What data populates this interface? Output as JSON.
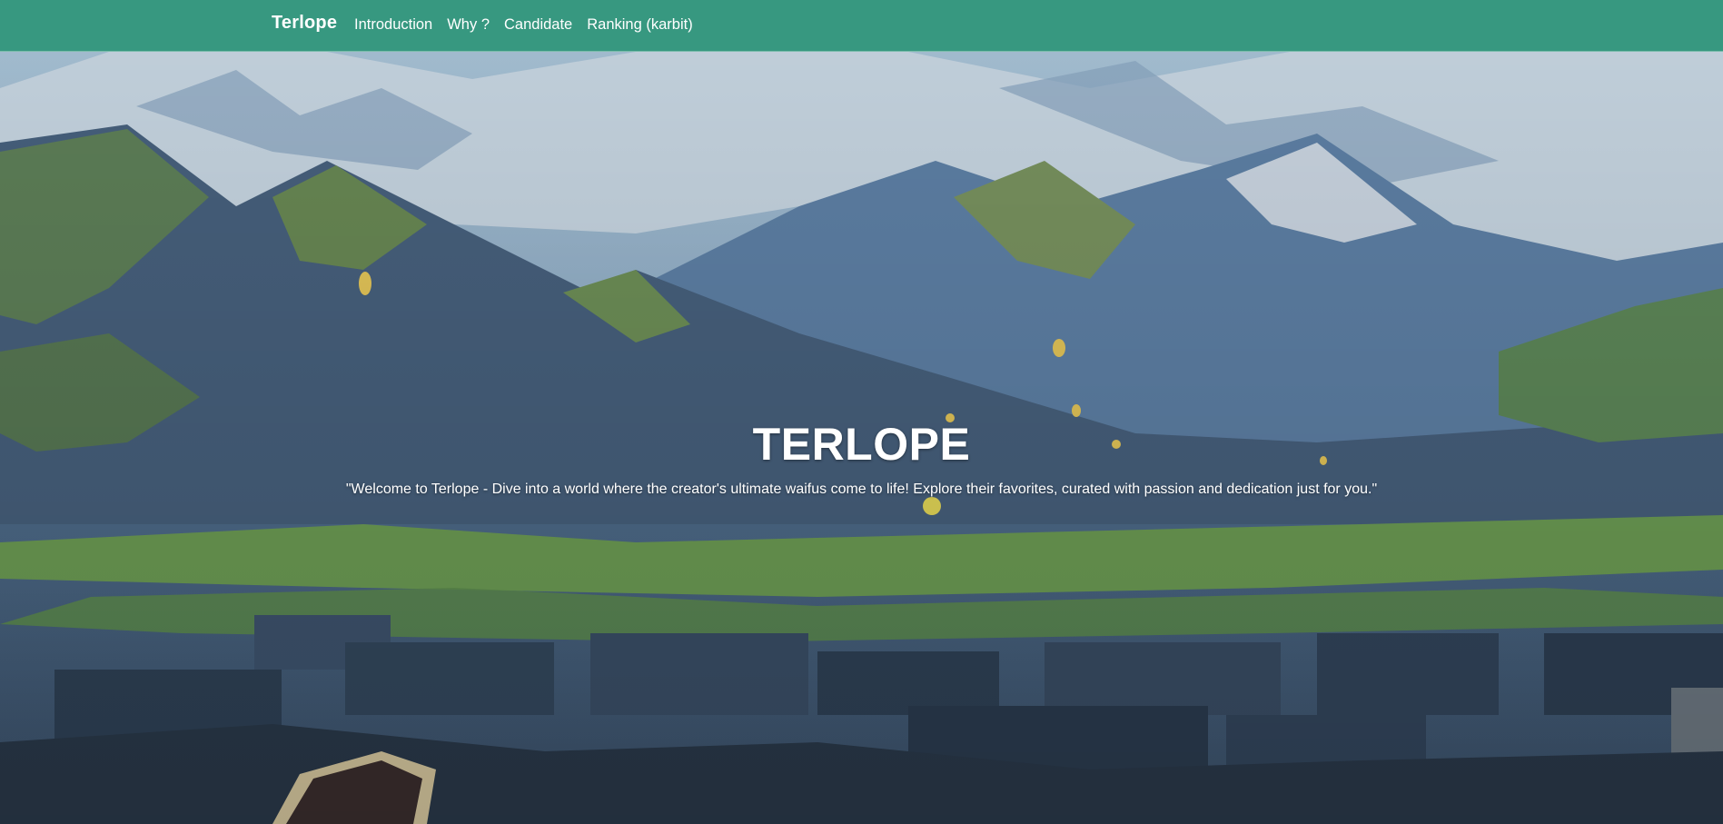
{
  "navbar": {
    "brand": "Terlope",
    "links": [
      {
        "label": "Introduction"
      },
      {
        "label": "Why ?"
      },
      {
        "label": "Candidate"
      },
      {
        "label": "Ranking (karbit)"
      }
    ],
    "background_color": "#379880"
  },
  "hero": {
    "title": "TERLOPE",
    "subtitle": "\"Welcome to Terlope - Dive into a world where the creator's ultimate waifus come to life! Explore their favorites, curated with passion and dedication just for you.\"",
    "background_image": "mountain-valley-landscape"
  }
}
